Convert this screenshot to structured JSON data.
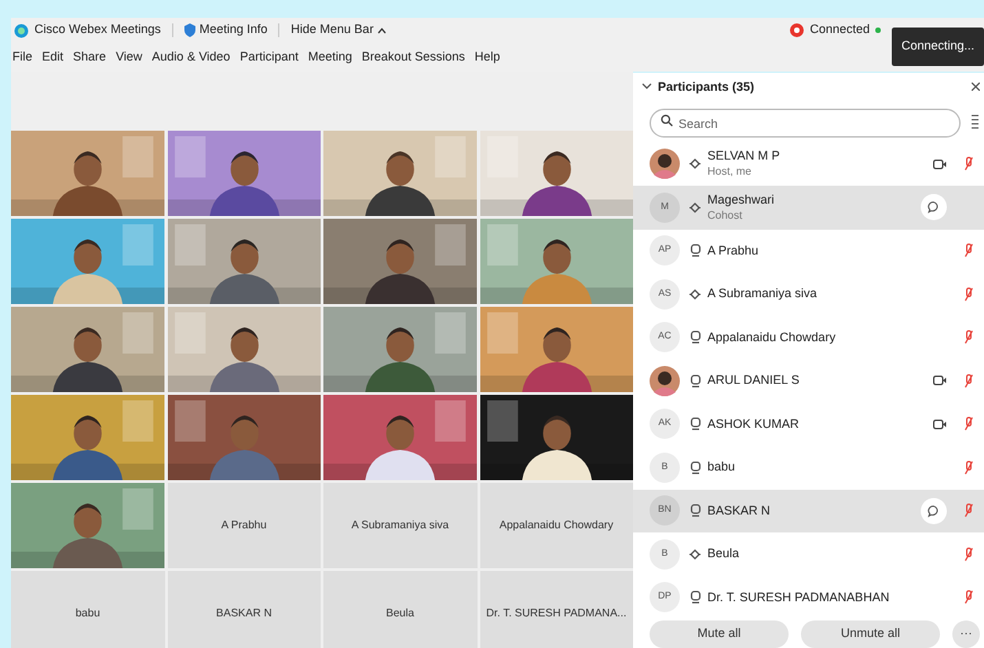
{
  "title_bar": {
    "app_name": "Cisco Webex Meetings",
    "meeting_info": "Meeting Info",
    "hide_menu_bar": "Hide Menu Bar",
    "status": "Connected",
    "tooltip": "Connecting..."
  },
  "menu": [
    "File",
    "Edit",
    "Share",
    "View",
    "Audio & Video",
    "Participant",
    "Meeting",
    "Breakout Sessions",
    "Help"
  ],
  "tiles": [
    {
      "kind": "video"
    },
    {
      "kind": "video"
    },
    {
      "kind": "video"
    },
    {
      "kind": "video"
    },
    {
      "kind": "video"
    },
    {
      "kind": "video"
    },
    {
      "kind": "video"
    },
    {
      "kind": "video"
    },
    {
      "kind": "video"
    },
    {
      "kind": "video"
    },
    {
      "kind": "video"
    },
    {
      "kind": "video"
    },
    {
      "kind": "video"
    },
    {
      "kind": "video"
    },
    {
      "kind": "video"
    },
    {
      "kind": "video"
    },
    {
      "kind": "video"
    },
    {
      "kind": "name",
      "name": "A Prabhu"
    },
    {
      "kind": "name",
      "name": "A Subramaniya siva"
    },
    {
      "kind": "name",
      "name": "Appalanaidu Chowdary"
    },
    {
      "kind": "name",
      "name": "babu"
    },
    {
      "kind": "name",
      "name": "BASKAR N"
    },
    {
      "kind": "name",
      "name": "Beula"
    },
    {
      "kind": "name",
      "name": "Dr. T. SURESH PADMANA..."
    }
  ],
  "participants_panel": {
    "title": "Participants (35)",
    "search": {
      "placeholder": "Search"
    },
    "participants": [
      {
        "name": "SELVAN M P",
        "role": "Host, me",
        "audio": {
          "kind": "call"
        },
        "camera": true,
        "muted": true,
        "selected": false
      },
      {
        "avatar": {
          "kind": "initials",
          "initials": "M"
        },
        "name": "Mageshwari",
        "role": "Cohost",
        "audio": {
          "kind": "call"
        },
        "camera": false,
        "muted": false,
        "selected": true
      },
      {
        "avatar": {
          "kind": "initials",
          "initials": "AP"
        },
        "name": "A Prabhu",
        "audio": {
          "kind": "computer"
        },
        "camera": false,
        "muted": true,
        "selected": false
      },
      {
        "avatar": {
          "kind": "initials",
          "initials": "AS"
        },
        "name": "A Subramaniya siva",
        "audio": {
          "kind": "call"
        },
        "camera": false,
        "muted": true,
        "selected": false
      },
      {
        "avatar": {
          "kind": "initials",
          "initials": "AC"
        },
        "name": "Appalanaidu Chowdary",
        "audio": {
          "kind": "computer"
        },
        "camera": false,
        "muted": true,
        "selected": false
      },
      {
        "name": "ARUL DANIEL S",
        "audio": {
          "kind": "computer"
        },
        "camera": true,
        "muted": true,
        "selected": false
      },
      {
        "avatar": {
          "kind": "initials",
          "initials": "AK"
        },
        "name": "ASHOK KUMAR",
        "audio": {
          "kind": "computer"
        },
        "camera": true,
        "muted": true,
        "selected": false
      },
      {
        "avatar": {
          "kind": "initials",
          "initials": "B"
        },
        "name": "babu",
        "audio": {
          "kind": "computer"
        },
        "camera": false,
        "muted": true,
        "selected": false
      },
      {
        "avatar": {
          "kind": "initials",
          "initials": "BN"
        },
        "name": "BASKAR N",
        "audio": {
          "kind": "computer"
        },
        "camera": false,
        "muted": true,
        "selected": true
      },
      {
        "avatar": {
          "kind": "initials",
          "initials": "B"
        },
        "name": "Beula",
        "audio": {
          "kind": "call"
        },
        "camera": false,
        "muted": true,
        "selected": false
      },
      {
        "avatar": {
          "kind": "initials",
          "initials": "DP"
        },
        "name": "Dr. T. SURESH PADMANABHAN",
        "audio": {
          "kind": "computer"
        },
        "camera": false,
        "muted": true,
        "selected": false
      }
    ],
    "buttons": [
      "Mute all",
      "Unmute all"
    ],
    "more": "···"
  }
}
